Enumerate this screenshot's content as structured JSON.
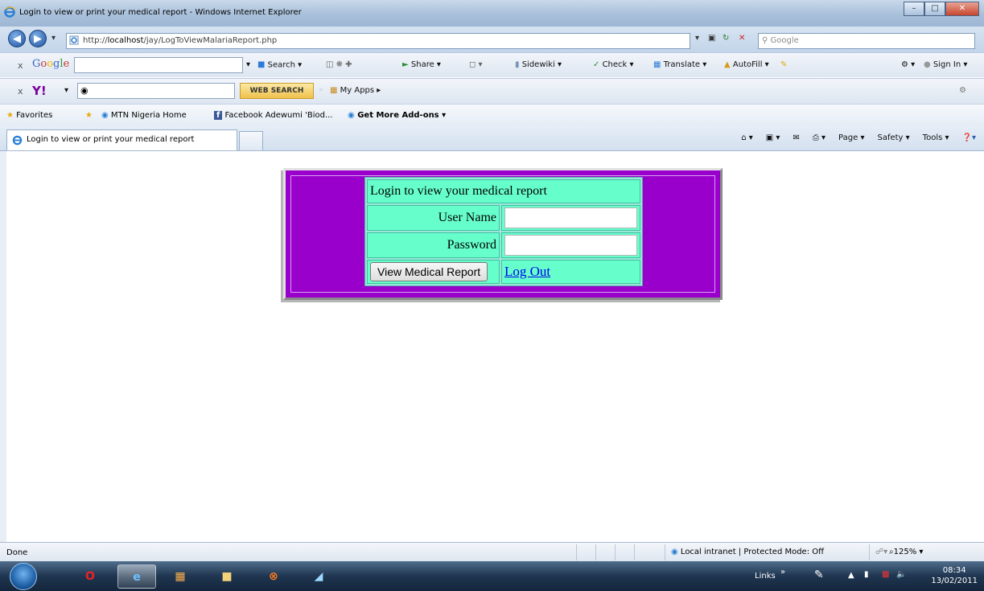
{
  "window": {
    "title": "Login to view or print your medical report - Windows Internet Explorer"
  },
  "address_bar": {
    "url_prefix": "http://",
    "url_host": "localhost",
    "url_path": "/jay/LogToViewMalariaReport.php",
    "search_placeholder": "Google"
  },
  "google_toolbar": {
    "close": "x",
    "brand": "Google",
    "items": [
      "Search",
      "Share",
      "Sidewiki",
      "Check",
      "Translate",
      "AutoFill"
    ],
    "sign_in": "Sign In"
  },
  "yahoo_toolbar": {
    "close": "x",
    "web_search": "WEB SEARCH",
    "my_apps": "My Apps"
  },
  "favorites_bar": {
    "favorites": "Favorites",
    "items": [
      "MTN Nigeria  Home",
      "Facebook  Adewumi 'Biod...",
      "Get More Add-ons"
    ]
  },
  "tab": {
    "title": "Login to view or print your medical report"
  },
  "command_bar": {
    "page": "Page",
    "safety": "Safety",
    "tools": "Tools"
  },
  "login_form": {
    "heading": "Login to view your medical report",
    "username_label": "User Name",
    "password_label": "Password",
    "submit_label": "View Medical Report",
    "logout_label": "Log Out"
  },
  "status_bar": {
    "status": "Done",
    "zone": "Local intranet | Protected Mode: Off",
    "zoom": "125%"
  },
  "taskbar": {
    "links": "Links",
    "time": "08:34",
    "date": "13/02/2011"
  }
}
